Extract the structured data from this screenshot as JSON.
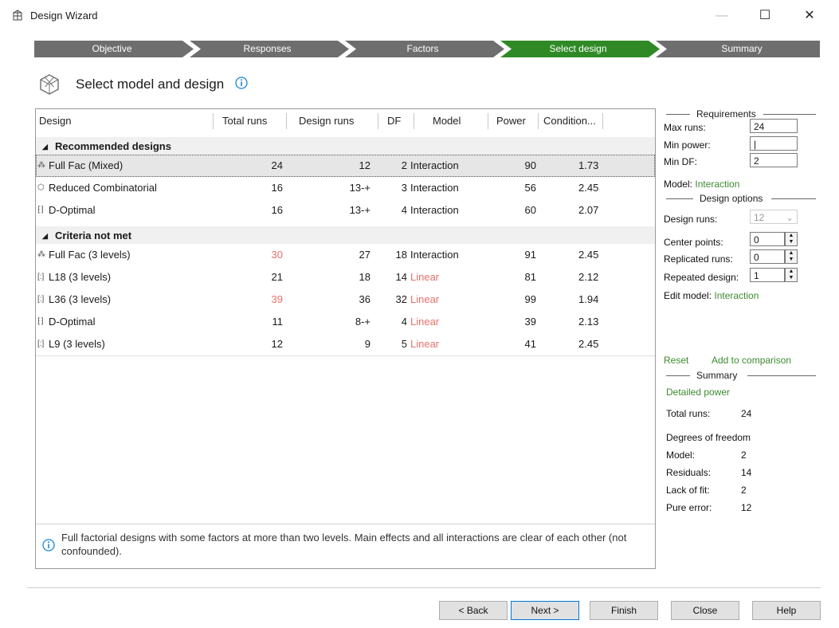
{
  "window": {
    "title": "Design Wizard",
    "minimize": "—",
    "maximize": "☐",
    "close": "✕"
  },
  "steps": [
    {
      "label": "Objective",
      "active": false
    },
    {
      "label": "Responses",
      "active": false
    },
    {
      "label": "Factors",
      "active": false
    },
    {
      "label": "Select design",
      "active": true
    },
    {
      "label": "Summary",
      "active": false
    }
  ],
  "header": {
    "title": "Select model and design",
    "info_icon": "info-icon"
  },
  "table": {
    "columns": [
      "Design",
      "Total runs",
      "Design runs",
      "DF",
      "Model",
      "Power",
      "Condition..."
    ],
    "groups": [
      {
        "label": "Recommended designs",
        "rows": [
          {
            "design": "Full Fac (Mixed)",
            "total_runs": "24",
            "design_runs": "12",
            "df": "2",
            "model": "Interaction",
            "power": "90",
            "condition": "1.73",
            "selected": true
          },
          {
            "design": "Reduced Combinatorial",
            "total_runs": "16",
            "design_runs": "13-+",
            "df": "3",
            "model": "Interaction",
            "power": "56",
            "condition": "2.45"
          },
          {
            "design": "D-Optimal",
            "total_runs": "16",
            "design_runs": "13-+",
            "df": "4",
            "model": "Interaction",
            "power": "60",
            "condition": "2.07"
          }
        ]
      },
      {
        "label": "Criteria not met",
        "rows": [
          {
            "design": "Full Fac (3 levels)",
            "total_runs": "30",
            "design_runs": "27",
            "df": "18",
            "model": "Interaction",
            "power": "91",
            "condition": "2.45",
            "total_red": true
          },
          {
            "design": "L18 (3 levels)",
            "total_runs": "21",
            "design_runs": "18",
            "df": "14",
            "model": "Linear",
            "power": "81",
            "condition": "2.12",
            "model_red": true
          },
          {
            "design": "L36 (3 levels)",
            "total_runs": "39",
            "design_runs": "36",
            "df": "32",
            "model": "Linear",
            "power": "99",
            "condition": "1.94",
            "total_red": true,
            "model_red": true
          },
          {
            "design": "D-Optimal",
            "total_runs": "11",
            "design_runs": "8-+",
            "df": "4",
            "model": "Linear",
            "power": "39",
            "condition": "2.13",
            "model_red": true
          },
          {
            "design": "L9 (3 levels)",
            "total_runs": "12",
            "design_runs": "9",
            "df": "5",
            "model": "Linear",
            "power": "41",
            "condition": "2.45",
            "model_red": true
          }
        ]
      }
    ],
    "info_text": "Full factorial designs with some factors at more than two levels. Main effects and all interactions are clear of each other (not confounded)."
  },
  "requirements": {
    "title": "Requirements",
    "max_runs_label": "Max runs:",
    "max_runs_value": "24",
    "min_power_label": "Min power:",
    "min_power_value": "|",
    "min_df_label": "Min DF:",
    "min_df_value": "2",
    "model_label": "Model:",
    "model_value": "Interaction"
  },
  "design_options": {
    "title": "Design options",
    "design_runs_label": "Design runs:",
    "design_runs_value": "12",
    "center_points_label": "Center points:",
    "center_points_value": "0",
    "replicated_runs_label": "Replicated runs:",
    "replicated_runs_value": "0",
    "repeated_design_label": "Repeated design:",
    "repeated_design_value": "1",
    "edit_model_label": "Edit model:",
    "edit_model_value": "Interaction"
  },
  "links": {
    "reset": "Reset",
    "add_to_comparison": "Add to comparison",
    "detailed_power": "Detailed power"
  },
  "summary": {
    "title": "Summary",
    "total_runs_label": "Total runs:",
    "total_runs_value": "24",
    "dof_heading": "Degrees of freedom",
    "model_label": "Model:",
    "model_value": "2",
    "residuals_label": "Residuals:",
    "residuals_value": "14",
    "lack_of_fit_label": "Lack of fit:",
    "lack_of_fit_value": "2",
    "pure_error_label": "Pure error:",
    "pure_error_value": "12"
  },
  "buttons": {
    "back": "< Back",
    "next": "Next >",
    "finish": "Finish",
    "close": "Close",
    "help": "Help"
  },
  "colors": {
    "step_inactive": "#6e6e6e",
    "step_active": "#2f8a26",
    "link_green": "#3d8a2f",
    "warn_red": "#e8706a",
    "info_blue": "#1a86d9"
  }
}
